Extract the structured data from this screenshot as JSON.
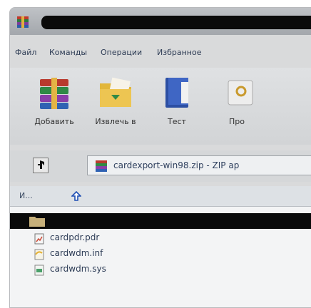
{
  "menu": {
    "items": [
      "Файл",
      "Команды",
      "Операции",
      "Избранное"
    ]
  },
  "toolbar": {
    "buttons": [
      {
        "label": "Добавить",
        "icon": "archive-add-icon"
      },
      {
        "label": "Извлечь в",
        "icon": "extract-folder-icon"
      },
      {
        "label": "Тест",
        "icon": "test-book-icon"
      },
      {
        "label": "Про",
        "icon": "view-icon"
      }
    ]
  },
  "pathbar": {
    "path": "cardexport-win98.zip - ZIP ар"
  },
  "list": {
    "header": "И...",
    "files": [
      {
        "name": "cardpdr.pdr",
        "icon": "pdr-file-icon"
      },
      {
        "name": "cardwdm.inf",
        "icon": "inf-file-icon"
      },
      {
        "name": "cardwdm.sys",
        "icon": "sys-file-icon"
      }
    ]
  },
  "colors": {
    "accent": "#2e3c55",
    "selection": "#0a0a0a"
  }
}
